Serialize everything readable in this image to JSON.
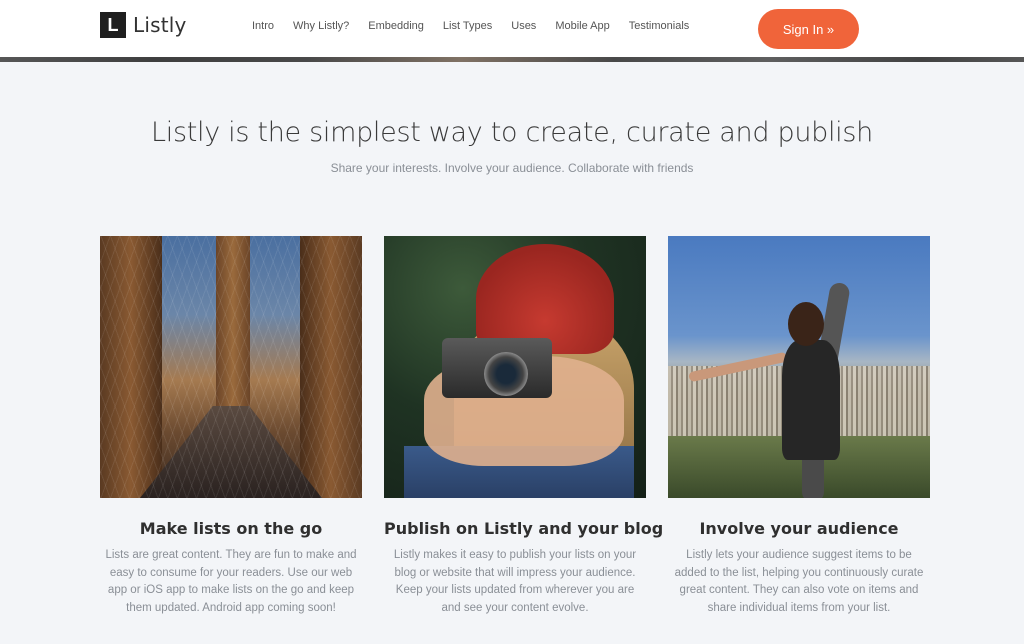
{
  "brand": {
    "logo_letter": "L",
    "name": "Listly"
  },
  "nav": {
    "links": [
      "Intro",
      "Why Listly?",
      "Embedding",
      "List Types",
      "Uses",
      "Mobile App",
      "Testimonials"
    ],
    "signin_label": "Sign In »"
  },
  "hero": {
    "headline": "Listly is the simplest way to create, curate and publish",
    "subhead": "Share your interests. Involve your audience. Collaborate with friends"
  },
  "cards": [
    {
      "title": "Make lists on the go",
      "text": "Lists are great content.  They are fun to make and easy to consume for your readers.  Use our web app or iOS app to make lists on the go and keep them updated.  Android app coming soon!"
    },
    {
      "title": "Publish on Listly and your blog",
      "text": "Listly makes it easy to publish your lists on your blog or website that will impress your audience.  Keep your lists updated from wherever you are and see your content evolve."
    },
    {
      "title": "Involve your audience",
      "text": "Listly lets your audience suggest items to be added to the list, helping you continuously curate great content.  They can also vote on items and share individual items from your list."
    }
  ],
  "colors": {
    "accent": "#f0643a",
    "background": "#f3f5f8"
  }
}
